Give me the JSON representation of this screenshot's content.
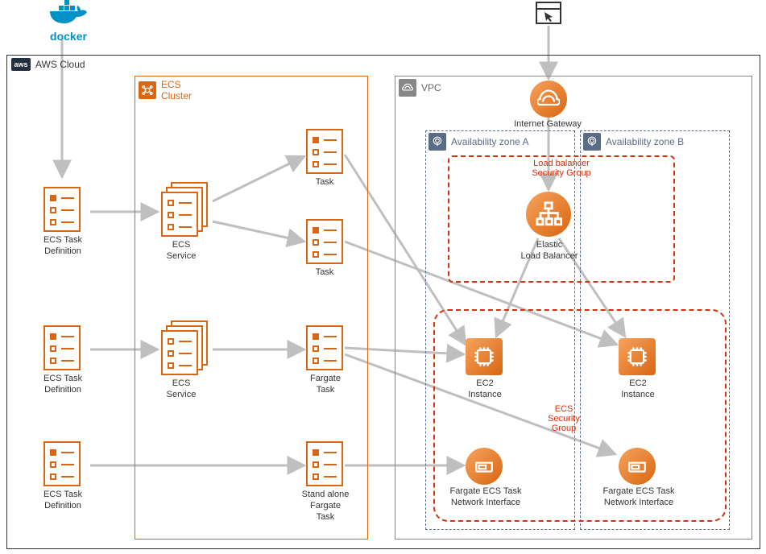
{
  "top": {
    "docker_label": "docker",
    "aws_badge": "aws",
    "aws_label": "AWS Cloud"
  },
  "groups": {
    "ecs_cluster": "ECS\nCluster",
    "vpc": "VPC",
    "az_a": "Availability zone A",
    "az_b": "Availability zone B",
    "lb_sg_l1": "Load balancer",
    "lb_sg_l2": "Security Group",
    "ecs_sg_l1": "ECS",
    "ecs_sg_l2": "Security",
    "ecs_sg_l3": "Group"
  },
  "nodes": {
    "td1": "ECS Task\nDefinition",
    "td2": "ECS Task\nDefinition",
    "td3": "ECS Task\nDefinition",
    "svc1": "ECS\nService",
    "svc2": "ECS\nService",
    "task1": "Task",
    "task2": "Task",
    "ftask": "Fargate\nTask",
    "satask": "Stand alone\nFargate\nTask",
    "igw": "Internet Gateway",
    "elb": "Elastic\nLoad Balancer",
    "ec2a": "EC2\nInstance",
    "ec2b": "EC2\nInstance",
    "fenia": "Fargate ECS Task\nNetwork Interface",
    "fenib": "Fargate ECS Task\nNetwork Interface"
  }
}
